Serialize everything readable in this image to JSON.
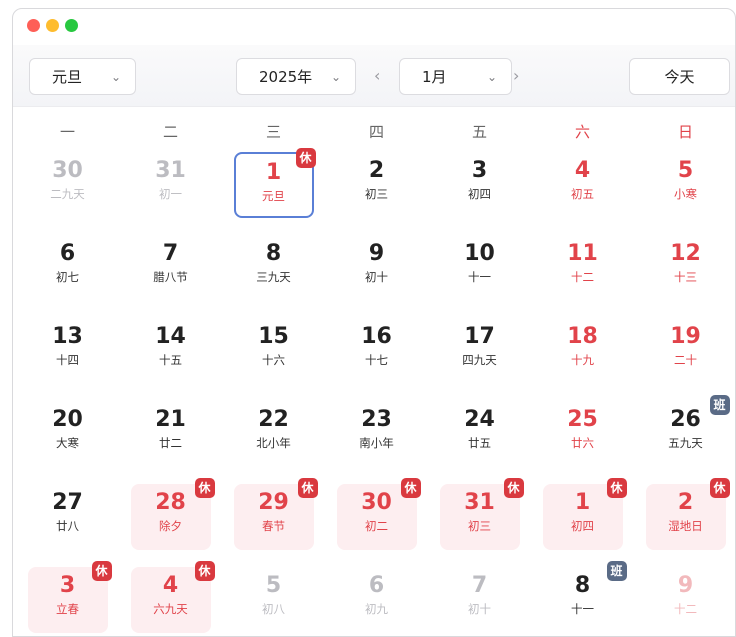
{
  "toolbar": {
    "holiday_select": "元旦",
    "year_select": "2025年",
    "month_select": "1月",
    "prev_arrow": "‹",
    "next_arrow": "›",
    "today_button": "今天",
    "chevron": "⌄"
  },
  "weekdays": [
    "一",
    "二",
    "三",
    "四",
    "五",
    "六",
    "日"
  ],
  "colors": {
    "accent_red": "#e1434a",
    "today_border": "#5a7fd6",
    "holiday_bg": "#fdeef0",
    "rest_badge": "#d9393f",
    "work_badge": "#5a6b86"
  },
  "weeks": [
    [
      {
        "day": "30",
        "lunar": "二九天",
        "state": "dim"
      },
      {
        "day": "31",
        "lunar": "初一",
        "state": "dim"
      },
      {
        "day": "1",
        "lunar": "元旦",
        "state": "today-red",
        "badge": "休"
      },
      {
        "day": "2",
        "lunar": "初三",
        "state": ""
      },
      {
        "day": "3",
        "lunar": "初四",
        "state": ""
      },
      {
        "day": "4",
        "lunar": "初五",
        "state": "red"
      },
      {
        "day": "5",
        "lunar": "小寒",
        "state": "red"
      }
    ],
    [
      {
        "day": "6",
        "lunar": "初七",
        "state": ""
      },
      {
        "day": "7",
        "lunar": "腊八节",
        "state": ""
      },
      {
        "day": "8",
        "lunar": "三九天",
        "state": ""
      },
      {
        "day": "9",
        "lunar": "初十",
        "state": ""
      },
      {
        "day": "10",
        "lunar": "十一",
        "state": ""
      },
      {
        "day": "11",
        "lunar": "十二",
        "state": "red"
      },
      {
        "day": "12",
        "lunar": "十三",
        "state": "red"
      }
    ],
    [
      {
        "day": "13",
        "lunar": "十四",
        "state": ""
      },
      {
        "day": "14",
        "lunar": "十五",
        "state": ""
      },
      {
        "day": "15",
        "lunar": "十六",
        "state": ""
      },
      {
        "day": "16",
        "lunar": "十七",
        "state": ""
      },
      {
        "day": "17",
        "lunar": "四九天",
        "state": ""
      },
      {
        "day": "18",
        "lunar": "十九",
        "state": "red"
      },
      {
        "day": "19",
        "lunar": "二十",
        "state": "red"
      }
    ],
    [
      {
        "day": "20",
        "lunar": "大寒",
        "state": ""
      },
      {
        "day": "21",
        "lunar": "廿二",
        "state": ""
      },
      {
        "day": "22",
        "lunar": "北小年",
        "state": ""
      },
      {
        "day": "23",
        "lunar": "南小年",
        "state": ""
      },
      {
        "day": "24",
        "lunar": "廿五",
        "state": ""
      },
      {
        "day": "25",
        "lunar": "廿六",
        "state": "red"
      },
      {
        "day": "26",
        "lunar": "五九天",
        "state": "",
        "badge": "班"
      }
    ],
    [
      {
        "day": "27",
        "lunar": "廿八",
        "state": ""
      },
      {
        "day": "28",
        "lunar": "除夕",
        "state": "holiday",
        "badge": "休"
      },
      {
        "day": "29",
        "lunar": "春节",
        "state": "holiday",
        "badge": "休"
      },
      {
        "day": "30",
        "lunar": "初二",
        "state": "holiday",
        "badge": "休"
      },
      {
        "day": "31",
        "lunar": "初三",
        "state": "holiday",
        "badge": "休"
      },
      {
        "day": "1",
        "lunar": "初四",
        "state": "holiday",
        "badge": "休"
      },
      {
        "day": "2",
        "lunar": "湿地日",
        "state": "holiday",
        "badge": "休"
      }
    ],
    [
      {
        "day": "3",
        "lunar": "立春",
        "state": "holiday",
        "badge": "休"
      },
      {
        "day": "4",
        "lunar": "六九天",
        "state": "holiday",
        "badge": "休"
      },
      {
        "day": "5",
        "lunar": "初八",
        "state": "dim"
      },
      {
        "day": "6",
        "lunar": "初九",
        "state": "dim"
      },
      {
        "day": "7",
        "lunar": "初十",
        "state": "dim"
      },
      {
        "day": "8",
        "lunar": "十一",
        "state": "",
        "badge": "班"
      },
      {
        "day": "9",
        "lunar": "十二",
        "state": "dimred"
      }
    ]
  ]
}
